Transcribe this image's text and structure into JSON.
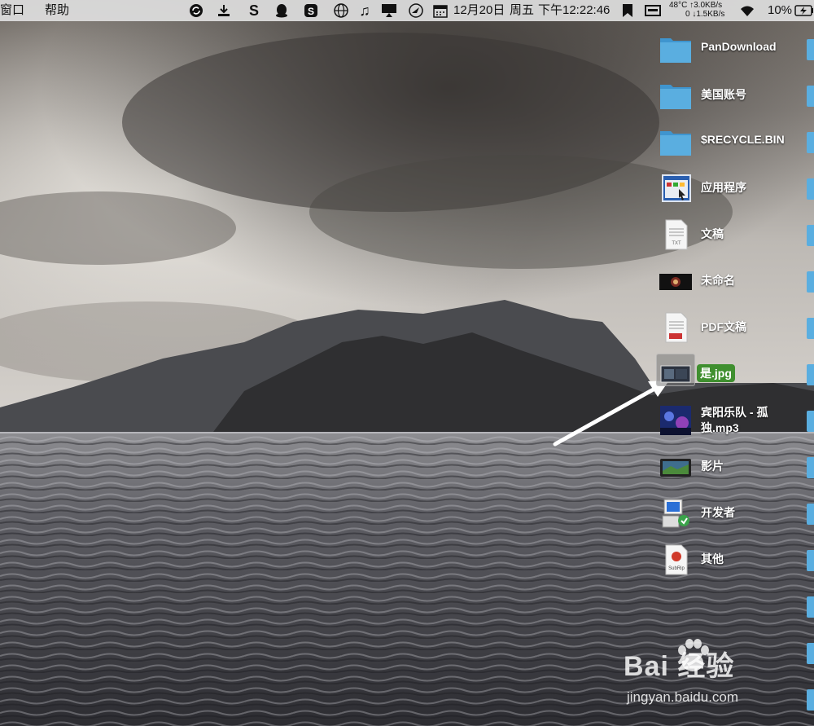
{
  "menubar": {
    "menus": [
      "窗口",
      "帮助"
    ],
    "date": "12月20日",
    "weekday": "周五",
    "time": "下午12:22:46",
    "temperature": "48°C",
    "temp_sub": "0",
    "net_up": "↑3.0KB/s",
    "net_down": "↓1.5KB/s",
    "battery": "10%",
    "icons": [
      "network-sync-icon",
      "download-icon",
      "s-app-icon",
      "qq-icon",
      "sogou-icon",
      "globe-icon",
      "music-note-icon",
      "screen-mirror-icon",
      "compass-icon",
      "calendar-icon",
      "bookmark-icon",
      "display-icon",
      "wifi-icon",
      "battery-icon"
    ]
  },
  "desktop_items": [
    {
      "label": "PanDownload",
      "icon": "folder"
    },
    {
      "label": "美国账号",
      "icon": "folder"
    },
    {
      "label": "$RECYCLE.BIN",
      "icon": "folder"
    },
    {
      "label": "应用程序",
      "icon": "app-window"
    },
    {
      "label": "文稿",
      "icon": "txt-document"
    },
    {
      "label": "未命名",
      "icon": "video-thumbnail"
    },
    {
      "label": "PDF文稿",
      "icon": "pdf-document"
    },
    {
      "label": "是.jpg",
      "icon": "image-thumbnail",
      "selected": true
    },
    {
      "label": "宾阳乐队 - 孤独.mp3",
      "icon": "album-art"
    },
    {
      "label": "影片",
      "icon": "movie"
    },
    {
      "label": "开发者",
      "icon": "developer"
    },
    {
      "label": "其他",
      "icon": "subrip"
    }
  ],
  "watermark": {
    "main": "Bai 经验",
    "sub": "jingyan.baidu.com"
  },
  "colors": {
    "folder": "#5aaee0",
    "selected_label": "#3f8f2f",
    "menubar": "#dedede"
  }
}
